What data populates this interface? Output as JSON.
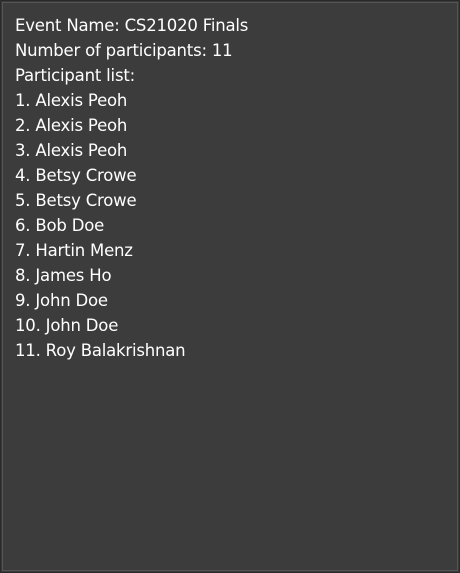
{
  "event": {
    "name_line": "Event Name: CS21020 Finals",
    "count_line": "Number of participants: 11",
    "list_heading": "Participant list:"
  },
  "participants": [
    "1. Alexis Peoh",
    "2. Alexis Peoh",
    "3. Alexis Peoh",
    "4. Betsy Crowe",
    "5. Betsy Crowe",
    "6. Bob Doe",
    "7. Hartin Menz",
    "8. James Ho",
    "9. John Doe",
    "10. John Doe",
    "11. Roy Balakrishnan"
  ]
}
